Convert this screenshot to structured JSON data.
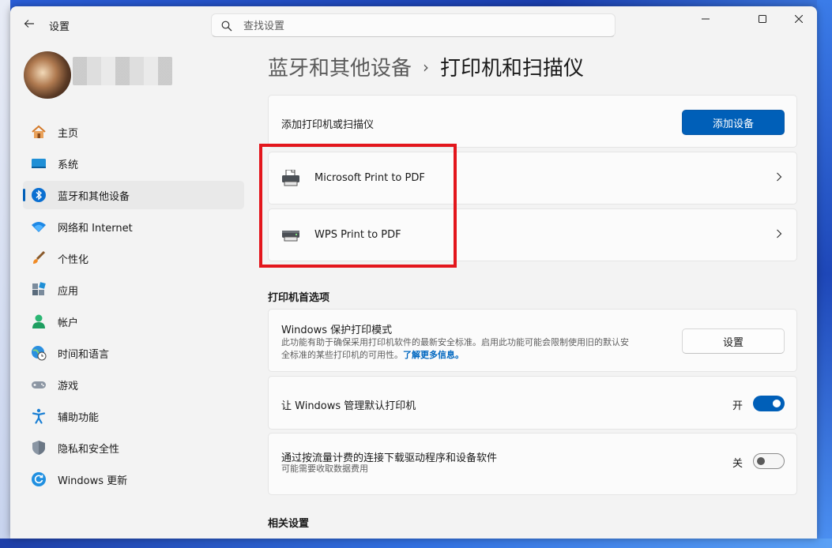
{
  "window": {
    "app_title": "设置",
    "controls": {
      "minimize": "minimize-icon",
      "maximize": "maximize-icon",
      "close": "close-icon"
    }
  },
  "search": {
    "placeholder": "查找设置"
  },
  "sidebar": {
    "items": [
      {
        "label": "主页",
        "icon": "home-icon",
        "selected": false
      },
      {
        "label": "系统",
        "icon": "system-icon",
        "selected": false
      },
      {
        "label": "蓝牙和其他设备",
        "icon": "bluetooth-icon",
        "selected": true
      },
      {
        "label": "网络和 Internet",
        "icon": "wifi-icon",
        "selected": false
      },
      {
        "label": "个性化",
        "icon": "brush-icon",
        "selected": false
      },
      {
        "label": "应用",
        "icon": "apps-icon",
        "selected": false
      },
      {
        "label": "帐户",
        "icon": "account-icon",
        "selected": false
      },
      {
        "label": "时间和语言",
        "icon": "time-language-icon",
        "selected": false
      },
      {
        "label": "游戏",
        "icon": "gamepad-icon",
        "selected": false
      },
      {
        "label": "辅助功能",
        "icon": "accessibility-icon",
        "selected": false
      },
      {
        "label": "隐私和安全性",
        "icon": "shield-icon",
        "selected": false
      },
      {
        "label": "Windows 更新",
        "icon": "update-icon",
        "selected": false
      }
    ]
  },
  "breadcrumb": {
    "parent": "蓝牙和其他设备",
    "separator": "›",
    "current": "打印机和扫描仪"
  },
  "add_device": {
    "label": "添加打印机或扫描仪",
    "button": "添加设备"
  },
  "printers": [
    {
      "name": "Microsoft Print to PDF",
      "icon": "printer-icon"
    },
    {
      "name": "WPS Print to PDF",
      "icon": "printer-icon"
    }
  ],
  "preferences": {
    "header": "打印机首选项",
    "protected_mode": {
      "title": "Windows 保护打印模式",
      "desc_line1": "此功能有助于确保采用打印机软件的最新安全标准。启用此功能可能会限制使用旧的默认安",
      "desc_line2": "全标准的某些打印机的可用性。",
      "link": "了解更多信息。",
      "button": "设置"
    },
    "manage_default": {
      "title": "让 Windows 管理默认打印机",
      "state_label": "开",
      "on": true
    },
    "metered_download": {
      "title": "通过按流量计费的连接下载驱动程序和设备软件",
      "desc": "可能需要收取数据费用",
      "state_label": "关",
      "on": false
    }
  },
  "related": {
    "header": "相关设置"
  },
  "colors": {
    "accent": "#005fb8",
    "highlight": "#e3161c"
  }
}
